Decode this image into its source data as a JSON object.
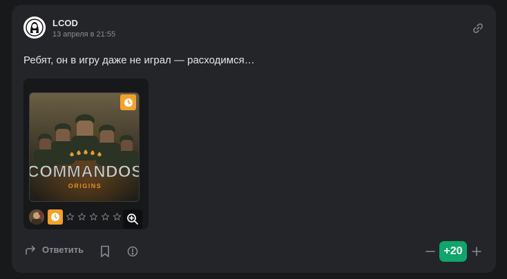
{
  "comment": {
    "author": "LCOD",
    "timestamp": "13 апреля в 21:55",
    "text": "Ребят, он в игру даже не играл — расходимся…"
  },
  "game": {
    "title": "COMMANDOS",
    "subtitle": "ORIGINS",
    "cover_badge_icon": "clock-icon",
    "rating_stars": 5,
    "rating_value": 0
  },
  "actions": {
    "reply_label": "Ответить"
  },
  "votes": {
    "score": "+20"
  },
  "colors": {
    "card_bg": "#232528",
    "page_bg": "#17191b",
    "accent_orange": "#f3a12c",
    "score_green": "#0fa56c"
  }
}
